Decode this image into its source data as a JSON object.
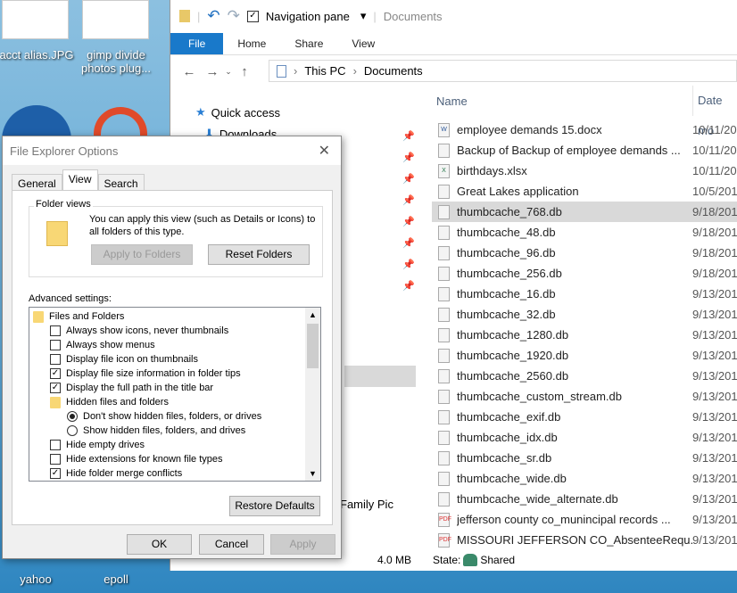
{
  "desktop": {
    "icons": [
      {
        "label": "acct alias.JPG"
      },
      {
        "label": "gimp divide photos plug..."
      },
      {
        "label": "yahoo"
      },
      {
        "label": "epoll"
      }
    ]
  },
  "explorer": {
    "qat": {
      "nav_pane_label": "Navigation pane",
      "nav_pane_checked": true,
      "title": "Documents"
    },
    "ribbon": {
      "tabs": [
        "File",
        "Home",
        "Share",
        "View"
      ]
    },
    "address": {
      "crumbs": [
        "This PC",
        "Documents"
      ]
    },
    "nav": {
      "items": [
        {
          "label": "Quick access"
        },
        {
          "label": "Downloads"
        },
        {
          "label": "Family Pic"
        }
      ]
    },
    "columns": {
      "name": "Name",
      "date": "Date mo"
    },
    "files": [
      {
        "name": "employee demands 15.docx",
        "date": "10/11/20",
        "type": "word"
      },
      {
        "name": "Backup of Backup of employee demands ...",
        "date": "10/11/20",
        "type": "doc"
      },
      {
        "name": "birthdays.xlsx",
        "date": "10/11/20",
        "type": "excel"
      },
      {
        "name": "Great Lakes application",
        "date": "10/5/201",
        "type": "doc"
      },
      {
        "name": "thumbcache_768.db",
        "date": "9/18/201",
        "type": "db",
        "selected": true
      },
      {
        "name": "thumbcache_48.db",
        "date": "9/18/201",
        "type": "db"
      },
      {
        "name": "thumbcache_96.db",
        "date": "9/18/201",
        "type": "db"
      },
      {
        "name": "thumbcache_256.db",
        "date": "9/18/201",
        "type": "db"
      },
      {
        "name": "thumbcache_16.db",
        "date": "9/13/201",
        "type": "db"
      },
      {
        "name": "thumbcache_32.db",
        "date": "9/13/201",
        "type": "db"
      },
      {
        "name": "thumbcache_1280.db",
        "date": "9/13/201",
        "type": "db"
      },
      {
        "name": "thumbcache_1920.db",
        "date": "9/13/201",
        "type": "db"
      },
      {
        "name": "thumbcache_2560.db",
        "date": "9/13/201",
        "type": "db"
      },
      {
        "name": "thumbcache_custom_stream.db",
        "date": "9/13/201",
        "type": "db"
      },
      {
        "name": "thumbcache_exif.db",
        "date": "9/13/201",
        "type": "db"
      },
      {
        "name": "thumbcache_idx.db",
        "date": "9/13/201",
        "type": "db"
      },
      {
        "name": "thumbcache_sr.db",
        "date": "9/13/201",
        "type": "db"
      },
      {
        "name": "thumbcache_wide.db",
        "date": "9/13/201",
        "type": "db"
      },
      {
        "name": "thumbcache_wide_alternate.db",
        "date": "9/13/201",
        "type": "db"
      },
      {
        "name": "jefferson county co_munincipal records ...",
        "date": "9/13/201",
        "type": "pdf"
      },
      {
        "name": "MISSOURI JEFFERSON CO_AbsenteeRequ...",
        "date": "9/13/201",
        "type": "pdf"
      }
    ],
    "status": {
      "size": "4.0 MB",
      "state_label": "State:",
      "state_value": "Shared"
    }
  },
  "dialog": {
    "title": "File Explorer Options",
    "tabs": [
      "General",
      "View",
      "Search"
    ],
    "folder_views": {
      "legend": "Folder views",
      "text": "You can apply this view (such as Details or Icons) to all folders of this type.",
      "apply_btn": "Apply to Folders",
      "reset_btn": "Reset Folders"
    },
    "advanced_label": "Advanced settings:",
    "tree": [
      {
        "kind": "folder",
        "label": "Files and Folders",
        "level": 0
      },
      {
        "kind": "check",
        "label": "Always show icons, never thumbnails",
        "checked": false,
        "level": 1
      },
      {
        "kind": "check",
        "label": "Always show menus",
        "checked": false,
        "level": 1
      },
      {
        "kind": "check",
        "label": "Display file icon on thumbnails",
        "checked": false,
        "level": 1
      },
      {
        "kind": "check",
        "label": "Display file size information in folder tips",
        "checked": true,
        "level": 1
      },
      {
        "kind": "check",
        "label": "Display the full path in the title bar",
        "checked": true,
        "level": 1
      },
      {
        "kind": "folder",
        "label": "Hidden files and folders",
        "level": 1
      },
      {
        "kind": "radio",
        "label": "Don't show hidden files, folders, or drives",
        "checked": true,
        "level": 2
      },
      {
        "kind": "radio",
        "label": "Show hidden files, folders, and drives",
        "checked": false,
        "level": 2
      },
      {
        "kind": "check",
        "label": "Hide empty drives",
        "checked": false,
        "level": 1
      },
      {
        "kind": "check",
        "label": "Hide extensions for known file types",
        "checked": false,
        "level": 1
      },
      {
        "kind": "check",
        "label": "Hide folder merge conflicts",
        "checked": true,
        "level": 1
      }
    ],
    "restore_btn": "Restore Defaults",
    "ok": "OK",
    "cancel": "Cancel",
    "apply": "Apply"
  }
}
